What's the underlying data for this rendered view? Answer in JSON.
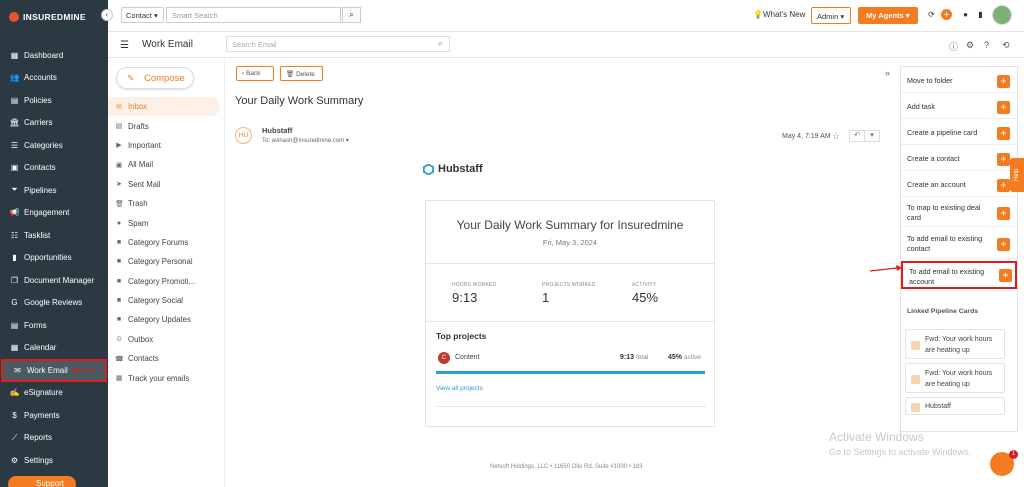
{
  "brand": {
    "name": "INSUREDMINE",
    "accent": "#f47b20",
    "sidebar_bg": "#2b3a42",
    "highlight": "#e21b1b"
  },
  "sidebar": {
    "items": [
      {
        "label": "Dashboard",
        "icon": "grid-icon"
      },
      {
        "label": "Accounts",
        "icon": "users-icon"
      },
      {
        "label": "Policies",
        "icon": "file-icon"
      },
      {
        "label": "Carriers",
        "icon": "bank-icon"
      },
      {
        "label": "Categories",
        "icon": "tags-icon"
      },
      {
        "label": "Contacts",
        "icon": "contacts-icon"
      },
      {
        "label": "Pipelines",
        "icon": "filter-icon"
      },
      {
        "label": "Engagement",
        "icon": "megaphone-icon"
      },
      {
        "label": "Tasklist",
        "icon": "list-icon"
      },
      {
        "label": "Opportunities",
        "icon": "chart-icon"
      },
      {
        "label": "Document Manager",
        "icon": "documents-icon"
      },
      {
        "label": "Google Reviews",
        "icon": "google-icon"
      },
      {
        "label": "Forms",
        "icon": "form-icon"
      },
      {
        "label": "Calendar",
        "icon": "calendar-icon"
      },
      {
        "label": "Work Email",
        "icon": "mail-icon",
        "active": true
      },
      {
        "label": "eSignature",
        "icon": "signature-icon"
      },
      {
        "label": "Payments",
        "icon": "dollar-icon"
      },
      {
        "label": "Reports",
        "icon": "line-chart-icon"
      },
      {
        "label": "Settings",
        "icon": "gear-icon"
      }
    ],
    "support_label": "Support"
  },
  "topbar": {
    "contact_select": "Contact",
    "smart_search_placeholder": "Smart Search",
    "whats_new": "What's New",
    "admin_select": "Admin",
    "my_agents": "My Agents"
  },
  "subheader": {
    "title": "Work Email",
    "search_placeholder": "Search Email"
  },
  "folders": {
    "compose": "Compose",
    "items": [
      {
        "label": "Inbox",
        "active": true
      },
      {
        "label": "Drafts"
      },
      {
        "label": "Important"
      },
      {
        "label": "All Mail"
      },
      {
        "label": "Sent Mail"
      },
      {
        "label": "Trash"
      },
      {
        "label": "Spam"
      },
      {
        "label": "Category Forums"
      },
      {
        "label": "Category Personal"
      },
      {
        "label": "Category Promoti..."
      },
      {
        "label": "Category Social"
      },
      {
        "label": "Category Updates"
      },
      {
        "label": "Outbox"
      },
      {
        "label": "Contacts"
      },
      {
        "label": "Track your emails"
      }
    ]
  },
  "email": {
    "back_label": "Back",
    "delete_label": "Delete",
    "subject": "Your Daily Work Summary",
    "sender_initials": "HU",
    "sender_name": "Hubstaff",
    "to_line": "To: avinash@insuredmine.com",
    "date": "May 4, 7:19 AM",
    "body": {
      "logo_text": "Hubstaff",
      "title": "Your Daily Work Summary for Insuredmine",
      "date": "Fri, May 3, 2024",
      "stats": [
        {
          "label": "HOURS WORKED",
          "value": "9:13"
        },
        {
          "label": "PROJECTS WORKED",
          "value": "1"
        },
        {
          "label": "ACTIVITY",
          "value": "45%"
        }
      ],
      "top_projects_label": "Top projects",
      "project": {
        "initial": "C",
        "name": "Content",
        "time": "9:13",
        "time_label": "total",
        "activity": "45%",
        "activity_label": "active",
        "progress": 1.0
      },
      "view_all": "View all projects",
      "footer": "Netsoft Holdings, LLC • 11650 Olio Rd. Suite #1000 • 183"
    }
  },
  "right_panel": {
    "actions": [
      {
        "label": "Move to folder"
      },
      {
        "label": "Add task"
      },
      {
        "label": "Create a pipeline card"
      },
      {
        "label": "Create a contact"
      },
      {
        "label": "Create an account"
      },
      {
        "label": "To map to existing deal card"
      },
      {
        "label": "To add email to existing contact"
      },
      {
        "label": "To add email to existing account",
        "highlight": true
      }
    ],
    "linked_title": "Linked Pipeline Cards",
    "linked_cards": [
      {
        "label": "Fwd: Your work hours are heating up"
      },
      {
        "label": "Fwd: Your work hours are heating up"
      },
      {
        "label": "Hubstaff"
      }
    ]
  },
  "help_label": "Help",
  "watermark": {
    "line1": "Activate Windows",
    "line2": "Go to Settings to activate Windows."
  },
  "chat_badge": "1"
}
